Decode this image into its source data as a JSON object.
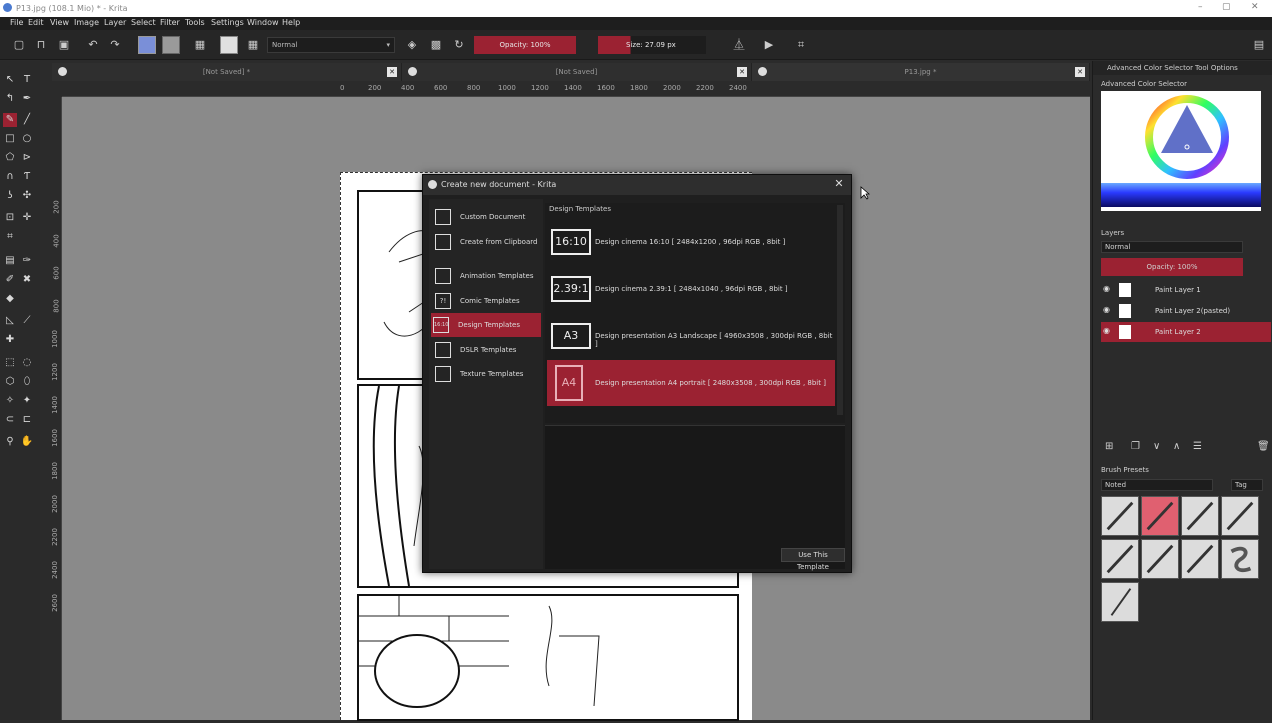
{
  "window": {
    "title": "P13.jpg (108.1 Mio) * - Krita"
  },
  "menu": [
    "File",
    "Edit",
    "View",
    "Image",
    "Layer",
    "Select",
    "Filter",
    "Tools",
    "Settings",
    "Window",
    "Help"
  ],
  "toolbar": {
    "blend_mode": "Normal",
    "opacity_label": "Opacity: 100%",
    "size_label": "Size: 27.09 px"
  },
  "tabs": [
    {
      "label": "[Not Saved] *"
    },
    {
      "label": "[Not Saved]"
    },
    {
      "label": "P13.jpg *"
    }
  ],
  "ruler_h": [
    "0",
    "200",
    "400",
    "600",
    "800",
    "1000",
    "1200",
    "1400",
    "1600",
    "1800",
    "2000",
    "2200",
    "2400"
  ],
  "ruler_v": [
    "200",
    "400",
    "600",
    "800",
    "1000",
    "1200",
    "1400",
    "1600",
    "1800",
    "2000",
    "2200",
    "2400",
    "2600"
  ],
  "dialog": {
    "title": "Create new document - Krita",
    "side_items": [
      {
        "label": "Custom Document",
        "icon": "doc-icon",
        "glyph": ""
      },
      {
        "label": "Create from Clipboard",
        "icon": "clipboard-icon",
        "glyph": ""
      },
      {
        "label": "Animation Templates",
        "icon": "film-icon",
        "glyph": ""
      },
      {
        "label": "Comic Templates",
        "icon": "speech-bubble-icon",
        "glyph": "?!"
      },
      {
        "label": "Design Templates",
        "icon": "design-icon",
        "glyph": "16:10"
      },
      {
        "label": "DSLR Templates",
        "icon": "camera-icon",
        "glyph": ""
      },
      {
        "label": "Texture Templates",
        "icon": "texture-icon",
        "glyph": ""
      }
    ],
    "active_side_index": 4,
    "list_header": "Design Templates",
    "templates": [
      {
        "icon_text": "16:10",
        "label": "Design cinema 16:10 [ 2484x1200 , 96dpi RGB , 8bit ]"
      },
      {
        "icon_text": "2.39:1",
        "label": "Design cinema 2.39:1 [ 2484x1040 , 96dpi RGB , 8bit ]"
      },
      {
        "icon_text": "A3",
        "label": "Design presentation A3 Landscape [ 4960x3508 , 300dpi RGB , 8bit ]"
      },
      {
        "icon_text": "A4",
        "label": "Design presentation A4 portrait [ 2480x3508 , 300dpi RGB , 8bit ]"
      }
    ],
    "active_template_index": 3,
    "use_button": "Use This Template"
  },
  "right_panel": {
    "tabs": [
      "Advanced Color Selector",
      "Tool Options"
    ],
    "color_selector_title": "Advanced Color Selector",
    "layers_title": "Layers",
    "layer_blend": "Normal",
    "layer_opacity": "Opacity: 100%",
    "layers": [
      {
        "name": "Paint Layer 1"
      },
      {
        "name": "Paint Layer 2(pasted)"
      },
      {
        "name": "Paint Layer 2"
      }
    ],
    "active_layer_index": 2,
    "brush_presets_title": "Brush Presets",
    "brush_filter": "Noted",
    "brush_tag": "Tag"
  },
  "colors": {
    "accent": "#9b2232",
    "bg": "#2b2b2b",
    "canvas": "#8a8a8a"
  }
}
